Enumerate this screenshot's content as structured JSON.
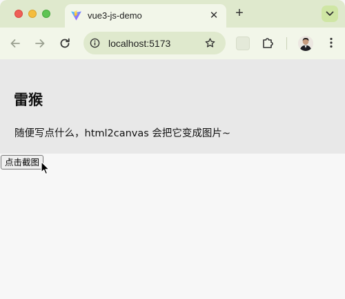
{
  "browser": {
    "tab": {
      "title": "vue3-js-demo",
      "close_glyph": "✕"
    },
    "new_tab_glyph": "+",
    "address": {
      "url": "localhost:5173"
    },
    "icons": [
      "vite-favicon-icon",
      "close-icon",
      "plus-icon",
      "tab-search-icon",
      "back-icon",
      "forward-icon",
      "reload-icon",
      "site-info-icon",
      "bookmark-star-icon",
      "extension-tile-icon",
      "extensions-puzzle-icon",
      "profile-avatar",
      "more-menu-icon"
    ]
  },
  "page": {
    "heading": "雷猴",
    "paragraph": "随便写点什么，html2canvas 会把它变成图片~",
    "capture_button": "点击截图"
  },
  "colors": {
    "tabbar": "#dfe9cd",
    "toolbar": "#f2f6e9",
    "capture_bg": "#e8e8e8",
    "page_bg": "#f7f7f7"
  }
}
